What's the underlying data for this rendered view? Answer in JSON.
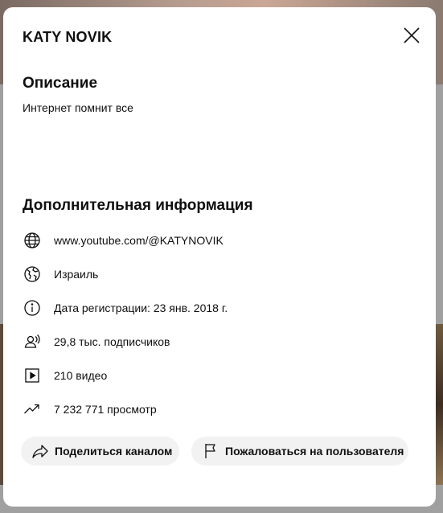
{
  "dialog": {
    "title": "KATY NOVIK",
    "close_icon": "close-icon"
  },
  "description": {
    "heading": "Описание",
    "text": "Интернет помнит все"
  },
  "info": {
    "heading": "Дополнительная информация",
    "items": [
      {
        "icon": "globe-icon",
        "text": "www.youtube.com/@KATYNOVIK"
      },
      {
        "icon": "world-map-icon",
        "text": "Израиль"
      },
      {
        "icon": "info-icon",
        "text": "Дата регистрации: 23 янв. 2018 г."
      },
      {
        "icon": "subscribers-icon",
        "text": "29,8 тыс. подписчиков"
      },
      {
        "icon": "video-icon",
        "text": "210 видео"
      },
      {
        "icon": "trending-icon",
        "text": "7 232 771 просмотр"
      }
    ]
  },
  "actions": {
    "share": {
      "icon": "share-icon",
      "label": "Поделиться каналом"
    },
    "report": {
      "icon": "flag-icon",
      "label": "Пожаловаться на пользователя"
    }
  }
}
